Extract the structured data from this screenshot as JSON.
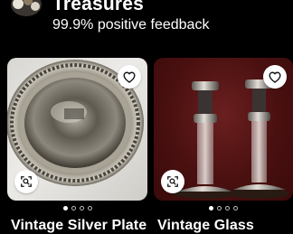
{
  "store": {
    "name": "Treasures",
    "feedback": "99.9% positive feedback"
  },
  "listings": [
    {
      "title": "Vintage Silver Plate",
      "image_icon": "silver-plate-bowl",
      "carousel_pages": 4,
      "carousel_active": 1
    },
    {
      "title": "Vintage Glass",
      "image_icon": "glass-candlesticks",
      "carousel_pages": 4,
      "carousel_active": 1
    }
  ],
  "icons": {
    "favorite": "heart-icon",
    "visual_search": "visual-search-icon"
  },
  "colors": {
    "background": "#000000",
    "text": "#ffffff"
  }
}
